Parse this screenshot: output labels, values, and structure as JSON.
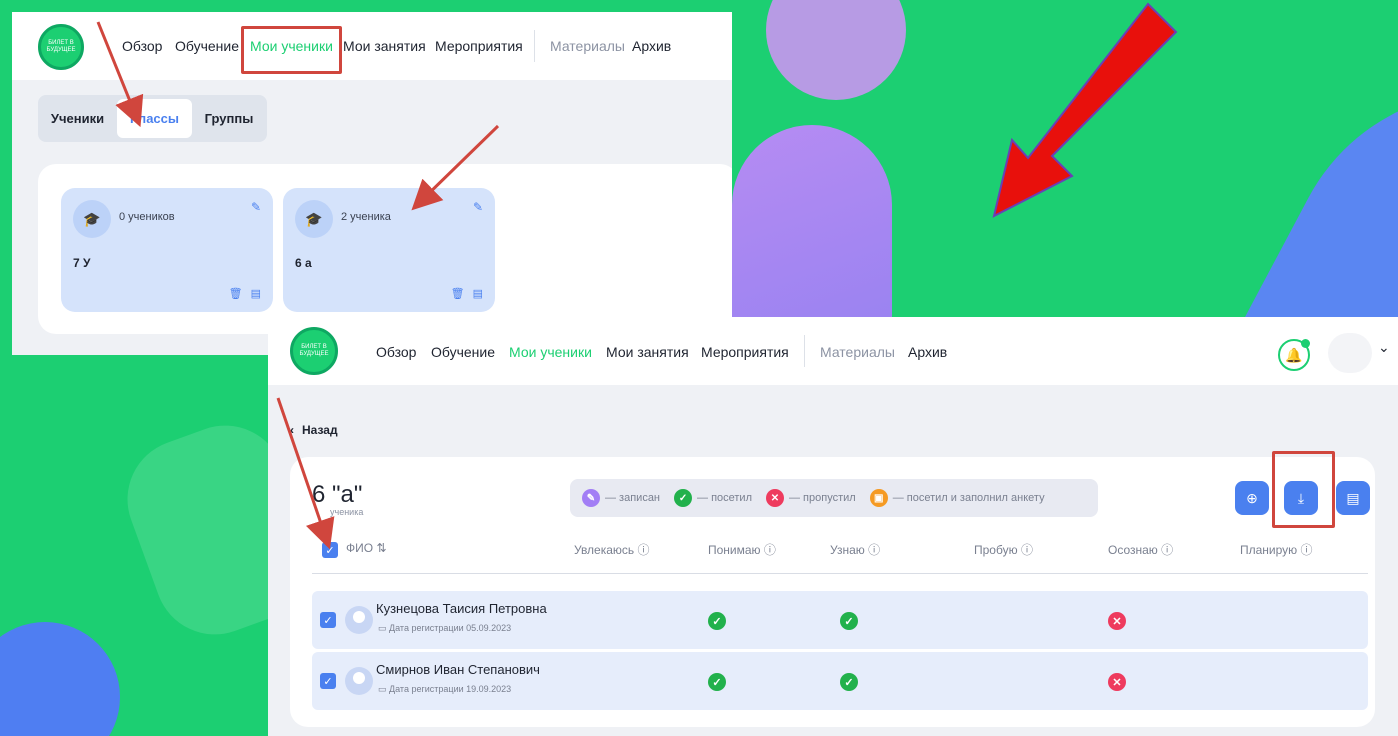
{
  "colors": {
    "brand_green": "#1ccf72",
    "accent_blue": "#4a80ef",
    "highlight_red": "#d0463d",
    "visited": "#22b14c",
    "missed": "#ee3b5e",
    "enrolled": "#a27ef5",
    "survey": "#f59a23"
  },
  "logo": {
    "text": "БИЛЕТ В БУДУЩЕЕ"
  },
  "nav": {
    "overview": "Обзор",
    "learning": "Обучение",
    "my_students": "Мои ученики",
    "my_lessons": "Мои занятия",
    "events": "Мероприятия",
    "materials": "Материалы",
    "archive": "Архив"
  },
  "tabs": {
    "students": "Ученики",
    "classes": "Классы",
    "groups": "Группы"
  },
  "class_cards": [
    {
      "count": "0 учеников",
      "name": "7 У"
    },
    {
      "count": "2 ученика",
      "name": "6 а"
    }
  ],
  "detail": {
    "back": "Назад",
    "title": "6 \"а\"",
    "subtitle": "ученика",
    "legend": [
      {
        "icon": "pencil-icon",
        "label": "— записан"
      },
      {
        "icon": "check-icon",
        "label": "— посетил"
      },
      {
        "icon": "cross-icon",
        "label": "— пропустил"
      },
      {
        "icon": "clipboard-icon",
        "label": "— посетил и заполнил анкету"
      }
    ],
    "columns": [
      "ФИО",
      "Увлекаюсь",
      "Понимаю",
      "Узнаю",
      "Пробую",
      "Осознаю",
      "Планирую"
    ],
    "rows": [
      {
        "name": "Кузнецова Таисия Петровна",
        "date": "Дата регистрации 05.09.2023",
        "marks": {
          "Понимаю": "visited",
          "Узнаю": "visited",
          "Осознаю": "missed"
        }
      },
      {
        "name": "Смирнов Иван Степанович",
        "date": "Дата регистрации 19.09.2023",
        "marks": {
          "Понимаю": "visited",
          "Узнаю": "visited",
          "Осознаю": "missed"
        }
      }
    ]
  },
  "icons": {
    "bell": "bell-icon",
    "download": "download-icon",
    "add": "plus-circle-icon",
    "archive": "archive-icon",
    "sort": "sort-icon",
    "info": "info-icon"
  }
}
